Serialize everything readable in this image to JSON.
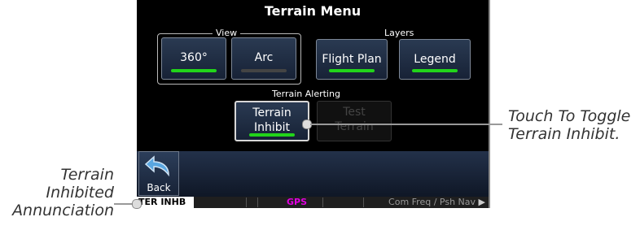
{
  "screen": {
    "title": "Terrain Menu",
    "view_group_label": "View",
    "layers_group_label": "Layers",
    "alerting_group_label": "Terrain Alerting",
    "buttons": {
      "view_360": "360°",
      "view_arc": "Arc",
      "flight_plan": "Flight Plan",
      "legend": "Legend",
      "terrain_inhibit_line1": "Terrain",
      "terrain_inhibit_line2": "Inhibit",
      "test_terrain_line1": "Test",
      "test_terrain_line2": "Terrain",
      "back": "Back"
    },
    "status_bar": {
      "annunciation": "TER INHB",
      "gps": "GPS",
      "com_freq": "Com Freq / Psh Nav",
      "com_freq_arrow": "▶"
    }
  },
  "callouts": {
    "touch_toggle_line1": "Touch To Toggle",
    "touch_toggle_line2": "Terrain Inhibit.",
    "annun_line1": "Terrain",
    "annun_line2": "Inhibited",
    "annun_line3": "Annunciation"
  },
  "colors": {
    "indicator_on": "#22d41a",
    "gps_text": "#e000e0"
  }
}
